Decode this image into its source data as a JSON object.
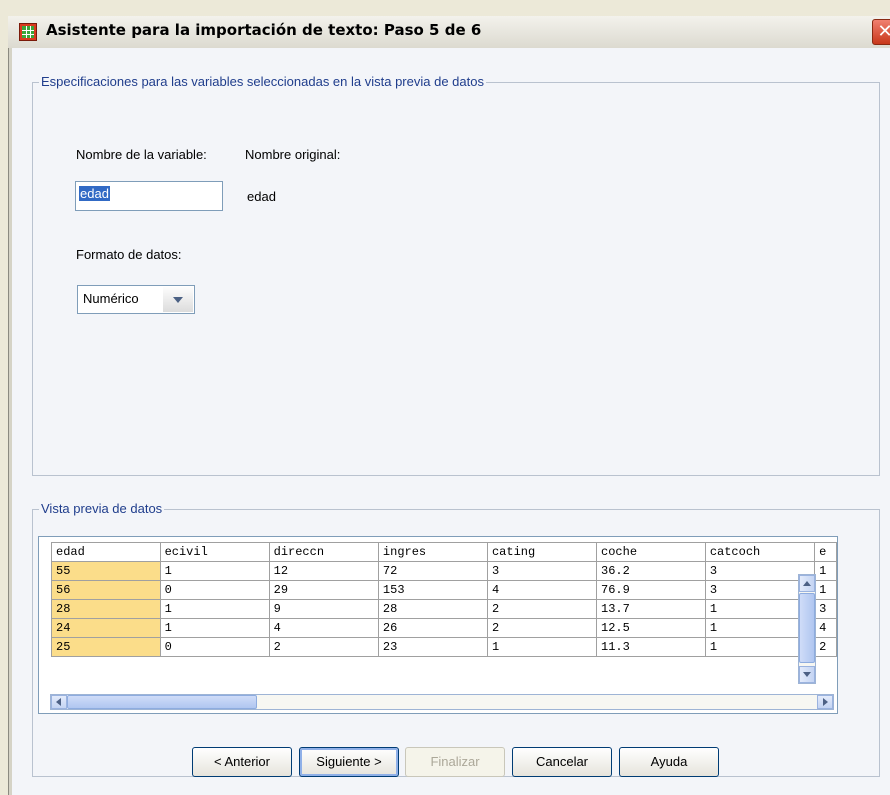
{
  "window": {
    "title": "Asistente para la importación de texto: Paso 5 de 6",
    "close_glyph": "✕"
  },
  "specs_group": {
    "caption": "Especificaciones para las variables seleccionadas en la vista previa de datos",
    "variable_name_label": "Nombre de la variable:",
    "original_name_label": "Nombre original:",
    "variable_name_value": "edad",
    "original_name_value": "edad",
    "data_format_label": "Formato de datos:",
    "data_format_value": "Numérico"
  },
  "preview_group": {
    "caption": "Vista previa de datos",
    "columns": [
      "edad",
      "ecivil",
      "direccn",
      "ingres",
      "cating",
      "coche",
      "catcoch",
      "e"
    ],
    "rows": [
      [
        "55",
        "1",
        "12",
        "72",
        "3",
        "36.2",
        "3",
        "1"
      ],
      [
        "56",
        "0",
        "29",
        "153",
        "4",
        "76.9",
        "3",
        "1"
      ],
      [
        "28",
        "1",
        "9",
        "28",
        "2",
        "13.7",
        "1",
        "3"
      ],
      [
        "24",
        "1",
        "4",
        "26",
        "2",
        "12.5",
        "1",
        "4"
      ],
      [
        "25",
        "0",
        "2",
        "23",
        "1",
        "11.3",
        "1",
        "2"
      ]
    ]
  },
  "buttons": {
    "back": "< Anterior",
    "next": "Siguiente >",
    "finish": "Finalizar",
    "cancel": "Cancelar",
    "help": "Ayuda"
  },
  "colors": {
    "title_text": "#000000",
    "caption_text": "#1f3d8c",
    "selected_column": "#fbdd8a",
    "selection": "#316ac5"
  },
  "icons": {
    "app": "spreadsheet-icon",
    "close": "close-icon"
  }
}
